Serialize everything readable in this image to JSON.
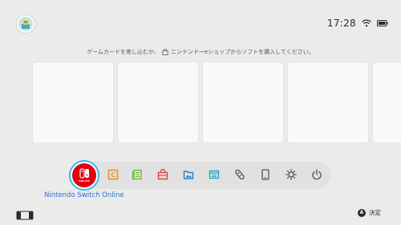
{
  "status": {
    "time": "17:28",
    "wifi_icon": "wifi-icon",
    "battery_icon": "battery-icon"
  },
  "user": {
    "avatar_icon": "user-avatar-icon"
  },
  "message": {
    "before_icon": "ゲームカードを差し込むか、",
    "after_icon": "ニンテンドーeショップからソフトを購入してください。",
    "inline_icon": "eshop-bag-icon"
  },
  "game_cards": [
    {
      "label": ""
    },
    {
      "label": ""
    },
    {
      "label": ""
    },
    {
      "label": ""
    },
    {
      "label": ""
    }
  ],
  "dock": {
    "selected_label": "Nintendo Switch Online",
    "nso_caption": "ONLINE",
    "items": [
      {
        "icon": "nintendo-switch-online-icon",
        "color": "#e4000f"
      },
      {
        "icon": "news-icon",
        "color": "#e8932b"
      },
      {
        "icon": "news-channel-icon",
        "color": "#6fbb2f"
      },
      {
        "icon": "eshop-icon",
        "color": "#e0483a"
      },
      {
        "icon": "album-icon",
        "color": "#2a80c7"
      },
      {
        "icon": "controllers-icon",
        "color": "#24a6b8"
      },
      {
        "icon": "joycon-icon",
        "color": "#555555"
      },
      {
        "icon": "sleep-mode-icon",
        "color": "#555555"
      },
      {
        "icon": "system-settings-icon",
        "color": "#555555"
      },
      {
        "icon": "power-icon",
        "color": "#555555"
      }
    ]
  },
  "footer": {
    "console_icon": "console-handheld-icon",
    "a_button": "A",
    "confirm_label": "決定"
  },
  "colors": {
    "background": "#ebebeb",
    "card": "#f9f9f9",
    "dock": "#e1e1e1",
    "selection_blue": "#2c6fd1",
    "selection_ring": "#2bc9e6"
  }
}
